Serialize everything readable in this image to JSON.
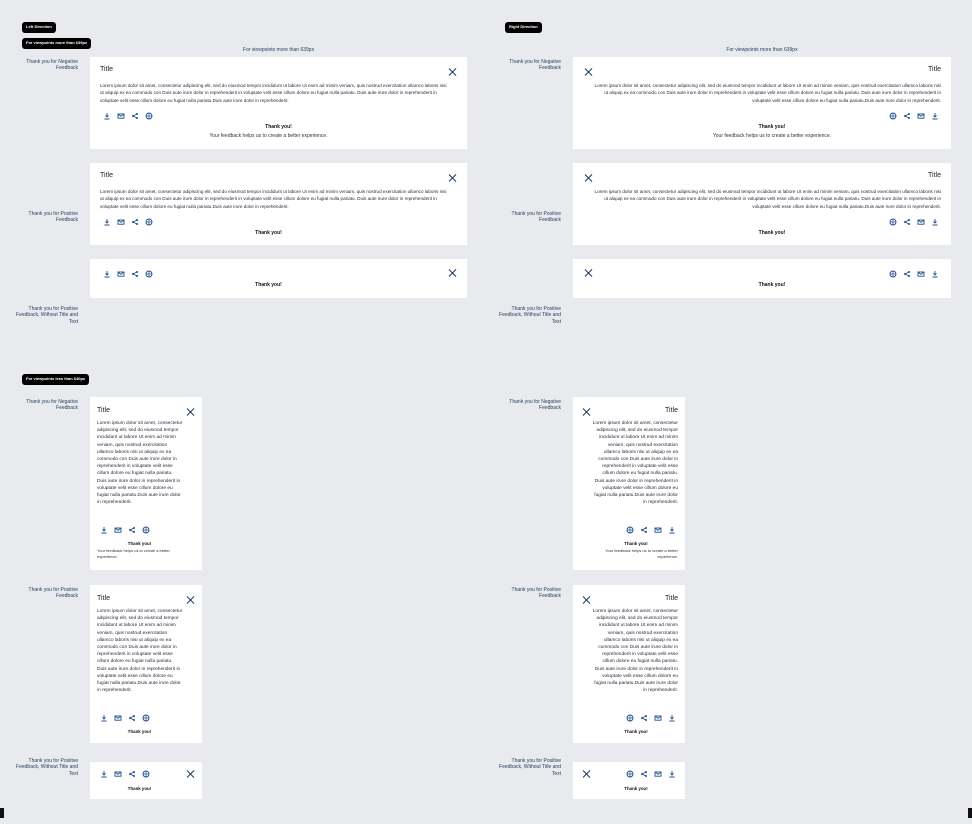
{
  "sections": {
    "left_direction": "Left Direction",
    "right_direction": "Right Direction",
    "large_viewport_tag": "For viewpoints more than 639px",
    "large_viewport_caption": "For viewpoints more than 639px",
    "small_viewport_tag": "For viewpoints less than 640px"
  },
  "labels": {
    "negative": "Thank you for Negative Feedback",
    "positive": "Thank you for Positive Feedback",
    "positive_no_title": "Thank you for Positive Feedback, Without Title and Text"
  },
  "card": {
    "title": "Title",
    "body": "Lorem ipsum dolor sit amet, consectetur adipiscing elit, sed do eiusmod tempor incididunt ut labore Ut enim ad minim veniam, quis nostrud exercitation ullamco laboris nisi ut aliquip ex ea commodo con Duis aute irure dolor in reprehenderit in voluptate velit esse cillum dolore eu fugiat nulla pariatu. Duis aute irure dolor in reprehenderit in voluptate velit esse cillum dolore eu fugiat nulla pariatu.Duis aute irure dolor in reprehenderit.",
    "thanks": "Thank you!",
    "feedback_line": "Your feedback helps us to create a better experience."
  },
  "icons": [
    "download-icon",
    "mail-icon",
    "share-icon",
    "print-icon",
    "close-icon"
  ]
}
